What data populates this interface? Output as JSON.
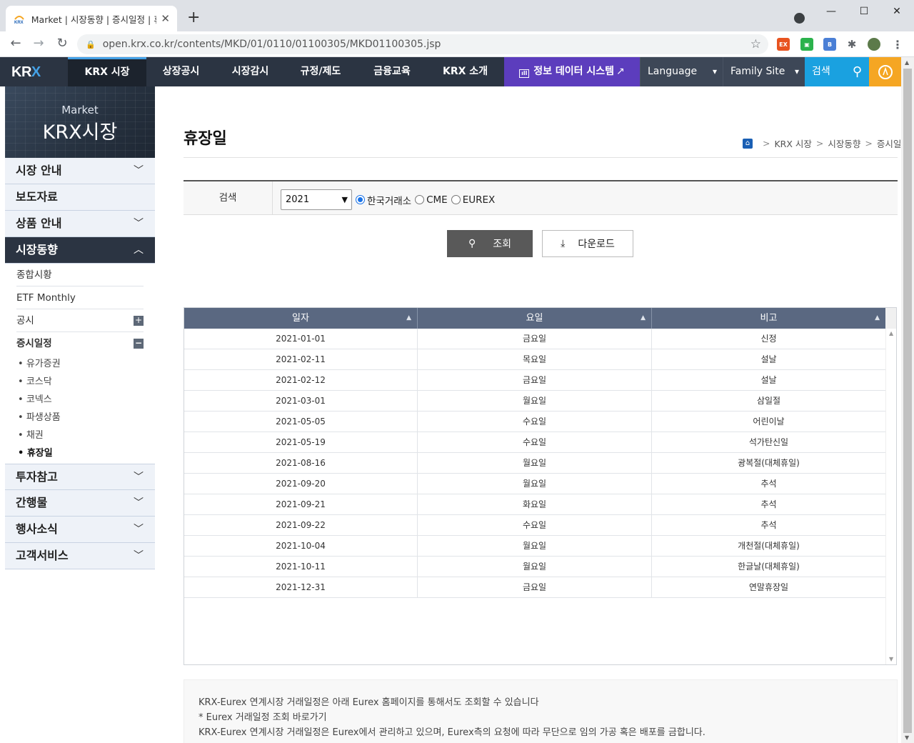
{
  "browser": {
    "tab_title": "Market | 시장동향 | 증시일정 | 휴",
    "url": "open.krx.co.kr/contents/MKD/01/0110/01100305/MKD01100305.jsp"
  },
  "header": {
    "logo_text": "KR",
    "logo_x": "X",
    "nav": [
      "KRX 시장",
      "상장공시",
      "시장감시",
      "규정/제도",
      "금융교육",
      "KRX 소개"
    ],
    "data_system": "정보 데이터 시스템",
    "language": "Language",
    "family_site": "Family Site",
    "search": "검색"
  },
  "sidebar": {
    "banner_sub": "Market",
    "banner_main": "KRX시장",
    "items_top": [
      "시장 안내",
      "보도자료",
      "상품 안내"
    ],
    "open_item": "시장동향",
    "sub_items": [
      "종합시황",
      "ETF Monthly",
      "공시",
      "증시일정"
    ],
    "leaves": [
      "유가증권",
      "코스닥",
      "코넥스",
      "파생상품",
      "채권",
      "휴장일"
    ],
    "items_bottom": [
      "투자참고",
      "간행물",
      "행사소식",
      "고객서비스"
    ]
  },
  "page": {
    "title": "휴장일",
    "breadcrumb": [
      "KRX 시장",
      "시장동향",
      "증시일정"
    ]
  },
  "search": {
    "label": "검색",
    "year": "2021",
    "radios": [
      "한국거래소",
      "CME",
      "EUREX"
    ],
    "selected_radio": "한국거래소",
    "search_button": "조회",
    "download_button": "다운로드"
  },
  "table": {
    "columns": [
      "일자",
      "요일",
      "비고"
    ],
    "rows": [
      [
        "2021-01-01",
        "금요일",
        "신정"
      ],
      [
        "2021-02-11",
        "목요일",
        "설날"
      ],
      [
        "2021-02-12",
        "금요일",
        "설날"
      ],
      [
        "2021-03-01",
        "월요일",
        "삼일절"
      ],
      [
        "2021-05-05",
        "수요일",
        "어린이날"
      ],
      [
        "2021-05-19",
        "수요일",
        "석가탄신일"
      ],
      [
        "2021-08-16",
        "월요일",
        "광복절(대체휴일)"
      ],
      [
        "2021-09-20",
        "월요일",
        "추석"
      ],
      [
        "2021-09-21",
        "화요일",
        "추석"
      ],
      [
        "2021-09-22",
        "수요일",
        "추석"
      ],
      [
        "2021-10-04",
        "월요일",
        "개천절(대체휴일)"
      ],
      [
        "2021-10-11",
        "월요일",
        "한글날(대체휴일)"
      ],
      [
        "2021-12-31",
        "금요일",
        "연말휴장일"
      ]
    ]
  },
  "notice": [
    "KRX-Eurex 연계시장 거래일정은 아래 Eurex 홈페이지를 통해서도 조회할 수 있습니다",
    "* Eurex 거래일정 조회 바로가기",
    "KRX-Eurex 연계시장 거래일정은 Eurex에서 관리하고 있으며, Eurex측의 요청에 따라 무단으로 임의 가공 혹은 배포를 금합니다."
  ]
}
